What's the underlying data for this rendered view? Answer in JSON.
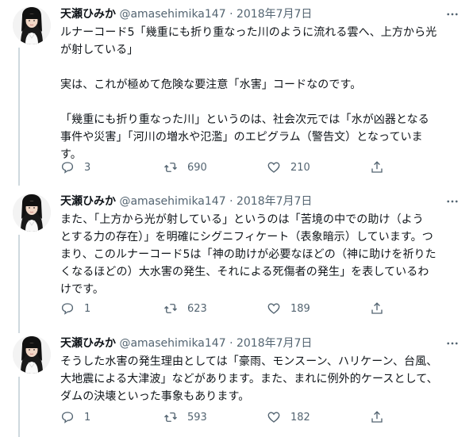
{
  "tweets": [
    {
      "name": "天瀬ひみか",
      "handle": "@amasehimika147",
      "dot": "·",
      "date": "2018年7月7日",
      "text": "ルナーコード5「幾重にも折り重なった川のように流れる雲へ、上方から光\nが射している」\n\n実は、これが極めて危険な要注意「水害」コードなのです。\n\n「幾重にも折り重なった川」というのは、社会次元では「水が凶器となる\n事件や災害」「河川の増水や氾濫」のエピグラム（警告文）となっていま\nす。",
      "reply_count": "3",
      "retweet_count": "690",
      "like_count": "210"
    },
    {
      "name": "天瀬ひみか",
      "handle": "@amasehimika147",
      "dot": "·",
      "date": "2018年7月7日",
      "text": "また、「上方から光が射している」というのは「苦境の中での助け（よう\nとする力の存在）」を明確にシグニフィケート（表象暗示）しています。つ\nまり、このルナーコード5は「神の助けが必要なほどの（神に助けを祈りた\nくなるほどの）大水害の発生、それによる死傷者の発生」を表しているわ\nけです。",
      "reply_count": "1",
      "retweet_count": "623",
      "like_count": "189"
    },
    {
      "name": "天瀬ひみか",
      "handle": "@amasehimika147",
      "dot": "·",
      "date": "2018年7月7日",
      "text": "そうした水害の発生理由としては「豪雨、モンスーン、ハリケーン、台風、\n大地震による大津波」などがあります。また、まれに例外的ケースとして、\nダムの決壊といった事象もあります。",
      "reply_count": "1",
      "retweet_count": "593",
      "like_count": "182"
    }
  ],
  "icons": {
    "reply": "reply-icon",
    "retweet": "retweet-icon",
    "like": "heart-icon",
    "share": "share-icon",
    "more": "more-options-icon"
  },
  "colors": {
    "text": "#0f1419",
    "secondary": "#536471",
    "thread_line": "#cfd9de",
    "background": "#ffffff"
  }
}
